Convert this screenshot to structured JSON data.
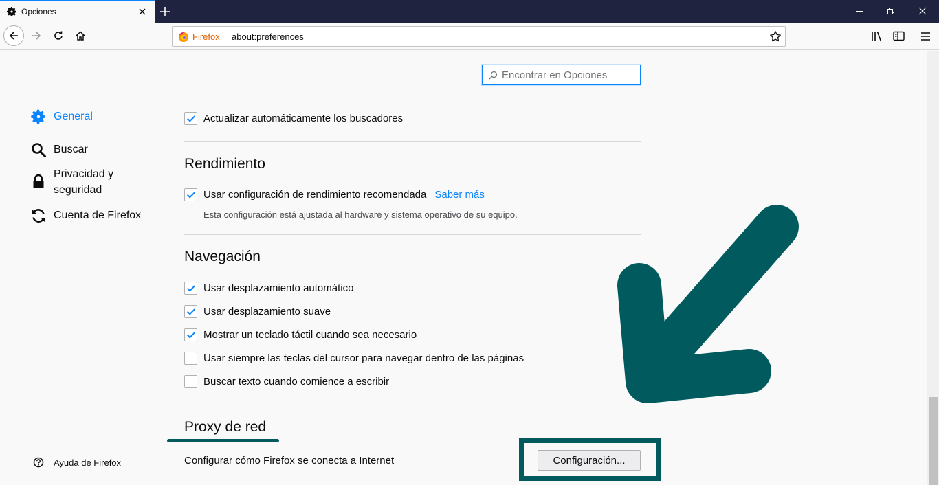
{
  "tab": {
    "title": "Opciones",
    "icon": "gear-icon"
  },
  "urlbar": {
    "identity": "Firefox",
    "url": "about:preferences"
  },
  "search": {
    "placeholder": "Encontrar en Opciones"
  },
  "sidebar": {
    "items": [
      {
        "label": "General",
        "icon": "gear-icon",
        "selected": true
      },
      {
        "label": "Buscar",
        "icon": "search-icon",
        "selected": false
      },
      {
        "label": "Privacidad y seguridad",
        "icon": "lock-icon",
        "selected": false
      },
      {
        "label": "Cuenta de Firefox",
        "icon": "sync-icon",
        "selected": false
      }
    ],
    "help": {
      "label": "Ayuda de Firefox",
      "icon": "help-icon"
    }
  },
  "main": {
    "update_search": {
      "label": "Actualizar automáticamente los buscadores",
      "checked": true
    },
    "performance": {
      "heading": "Rendimiento",
      "recommended": {
        "label": "Usar configuración de rendimiento recomendada",
        "checked": true
      },
      "learn_more": "Saber más",
      "description": "Esta configuración está ajustada al hardware y sistema operativo de su equipo."
    },
    "browsing": {
      "heading": "Navegación",
      "options": [
        {
          "label": "Usar desplazamiento automático",
          "checked": true
        },
        {
          "label": "Usar desplazamiento suave",
          "checked": true
        },
        {
          "label": "Mostrar un teclado táctil cuando sea necesario",
          "checked": true
        },
        {
          "label": "Usar siempre las teclas del cursor para navegar dentro de las páginas",
          "checked": false
        },
        {
          "label": "Buscar texto cuando comience a escribir",
          "checked": false
        }
      ]
    },
    "proxy": {
      "heading": "Proxy de red",
      "description": "Configurar cómo Firefox se conecta a Internet",
      "button": "Configuración..."
    }
  },
  "colors": {
    "accent": "#0a84ff",
    "annotation": "#005a5e",
    "tabbar": "#202340"
  }
}
